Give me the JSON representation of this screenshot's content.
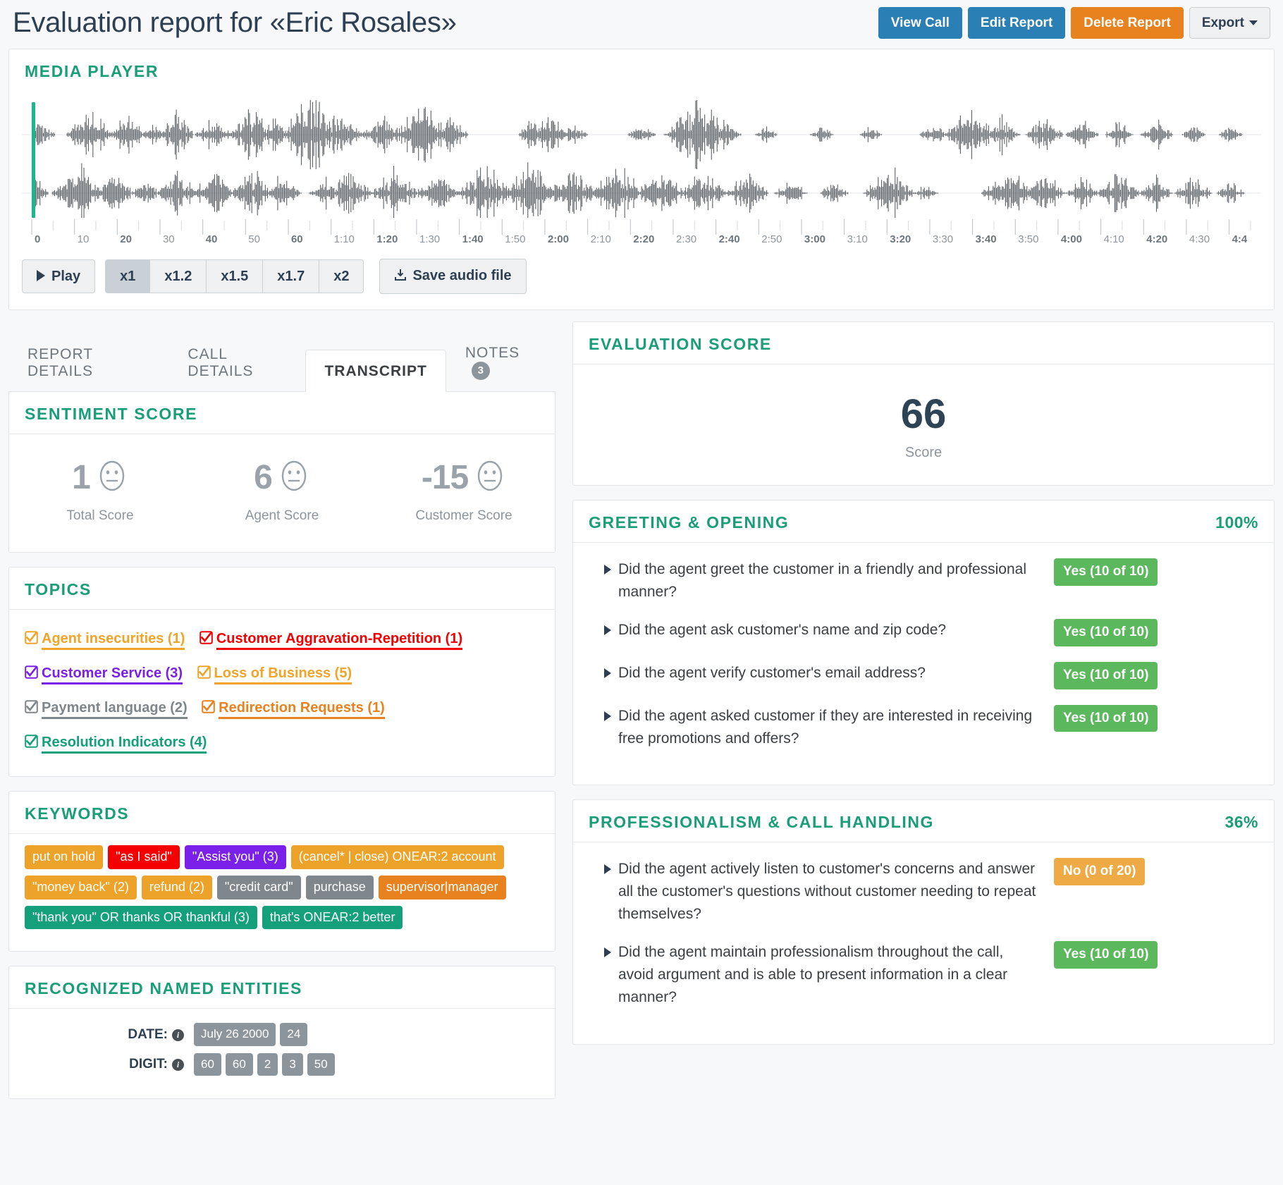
{
  "header": {
    "title": "Evaluation report for «Eric Rosales»",
    "buttons": [
      {
        "label": "View Call",
        "style": "blue",
        "name": "view-call-button"
      },
      {
        "label": "Edit Report",
        "style": "blue",
        "name": "edit-report-button"
      },
      {
        "label": "Delete Report",
        "style": "orange",
        "name": "delete-report-button"
      },
      {
        "label": "Export",
        "style": "default",
        "name": "export-button",
        "caret": true
      }
    ]
  },
  "media_player": {
    "title": "Media Player",
    "playhead_position": "0",
    "ruler_ticks": [
      "0",
      "10",
      "20",
      "30",
      "40",
      "50",
      "60",
      "1:10",
      "1:20",
      "1:30",
      "1:40",
      "1:50",
      "2:00",
      "2:10",
      "2:20",
      "2:30",
      "2:40",
      "2:50",
      "3:00",
      "3:10",
      "3:20",
      "3:30",
      "3:40",
      "3:50",
      "4:00",
      "4:10",
      "4:20",
      "4:30",
      "4:4"
    ],
    "play_label": "Play",
    "speeds": [
      "x1",
      "x1.2",
      "x1.5",
      "x1.7",
      "x2"
    ],
    "active_speed": "x1",
    "save_label": "Save audio file"
  },
  "tabs": [
    {
      "label": "Report Details",
      "active": false,
      "badge": null
    },
    {
      "label": "Call Details",
      "active": false,
      "badge": null
    },
    {
      "label": "Transcript",
      "active": true,
      "badge": null
    },
    {
      "label": "Notes",
      "active": false,
      "badge": "3"
    }
  ],
  "sentiment": {
    "title": "Sentiment Score",
    "items": [
      {
        "value": "1",
        "label": "Total Score",
        "face": "neutral"
      },
      {
        "value": "6",
        "label": "Agent Score",
        "face": "neutral"
      },
      {
        "value": "-15",
        "label": "Customer Score",
        "face": "neutral"
      }
    ]
  },
  "topics": {
    "title": "Topics",
    "items": [
      {
        "label": "Agent insecurities (1)",
        "color": "#f0a429"
      },
      {
        "label": "Customer Aggravation-Repetition (1)",
        "color": "#f40000"
      },
      {
        "label": "Customer Service (3)",
        "color": "#7b20e8"
      },
      {
        "label": "Loss of Business (5)",
        "color": "#f0a429"
      },
      {
        "label": "Payment language (2)",
        "color": "#7f868c"
      },
      {
        "label": "Redirection Requests (1)",
        "color": "#e8821e"
      },
      {
        "label": "Resolution Indicators (4)",
        "color": "#13a07b"
      }
    ]
  },
  "keywords": {
    "title": "Keywords",
    "items": [
      {
        "label": "put on hold",
        "color": "#eda32a"
      },
      {
        "label": "\"as I said\"",
        "color": "#f40000"
      },
      {
        "label": "\"Assist you\" (3)",
        "color": "#7b20e8"
      },
      {
        "label": "(cancel* | close) ONEAR:2 account",
        "color": "#eda32a"
      },
      {
        "label": "\"money back\" (2)",
        "color": "#eda32a"
      },
      {
        "label": "refund (2)",
        "color": "#eda32a"
      },
      {
        "label": "\"credit card\"",
        "color": "#7f868c"
      },
      {
        "label": "purchase",
        "color": "#7f868c"
      },
      {
        "label": "supervisor|manager",
        "color": "#e8821e"
      },
      {
        "label": "\"thank you\" OR thanks OR thankful (3)",
        "color": "#13a07b"
      },
      {
        "label": "that's ONEAR:2 better",
        "color": "#13a07b"
      }
    ]
  },
  "entities": {
    "title": "Recognized Named Entities",
    "rows": [
      {
        "label": "DATE:",
        "values": [
          "July 26 2000",
          "24"
        ]
      },
      {
        "label": "DIGIT:",
        "values": [
          "60",
          "60",
          "2",
          "3",
          "50"
        ]
      }
    ]
  },
  "evaluation_score": {
    "title": "Evaluation Score",
    "value": "66",
    "label": "Score"
  },
  "sections": [
    {
      "title": "Greeting & Opening",
      "percent": "100%",
      "questions": [
        {
          "text": "Did the agent greet the customer in a friendly and professional manner?",
          "result": "Yes (10 of 10)",
          "state": "yes"
        },
        {
          "text": "Did the agent ask customer's name and zip code?",
          "result": "Yes (10 of 10)",
          "state": "yes"
        },
        {
          "text": "Did the agent verify customer's email address?",
          "result": "Yes (10 of 10)",
          "state": "yes"
        },
        {
          "text": "Did the agent asked customer if they are interested in receiving free promotions and offers?",
          "result": "Yes (10 of 10)",
          "state": "yes"
        }
      ]
    },
    {
      "title": "Professionalism & Call Handling",
      "percent": "36%",
      "questions": [
        {
          "text": "Did the agent actively listen to customer's concerns and answer all the customer's questions without customer needing to repeat themselves?",
          "result": "No (0 of 20)",
          "state": "no"
        },
        {
          "text": "Did the agent maintain professionalism throughout the call, avoid argument and is able to present information in a clear manner?",
          "result": "Yes (10 of 10)",
          "state": "yes"
        }
      ]
    }
  ],
  "colors": {
    "accent_green": "#1a9e79",
    "blue": "#2a7fb5",
    "orange": "#e8821e",
    "playhead": "#16b98a",
    "badge_yes": "#5cb85c",
    "badge_no": "#eeaa44"
  }
}
